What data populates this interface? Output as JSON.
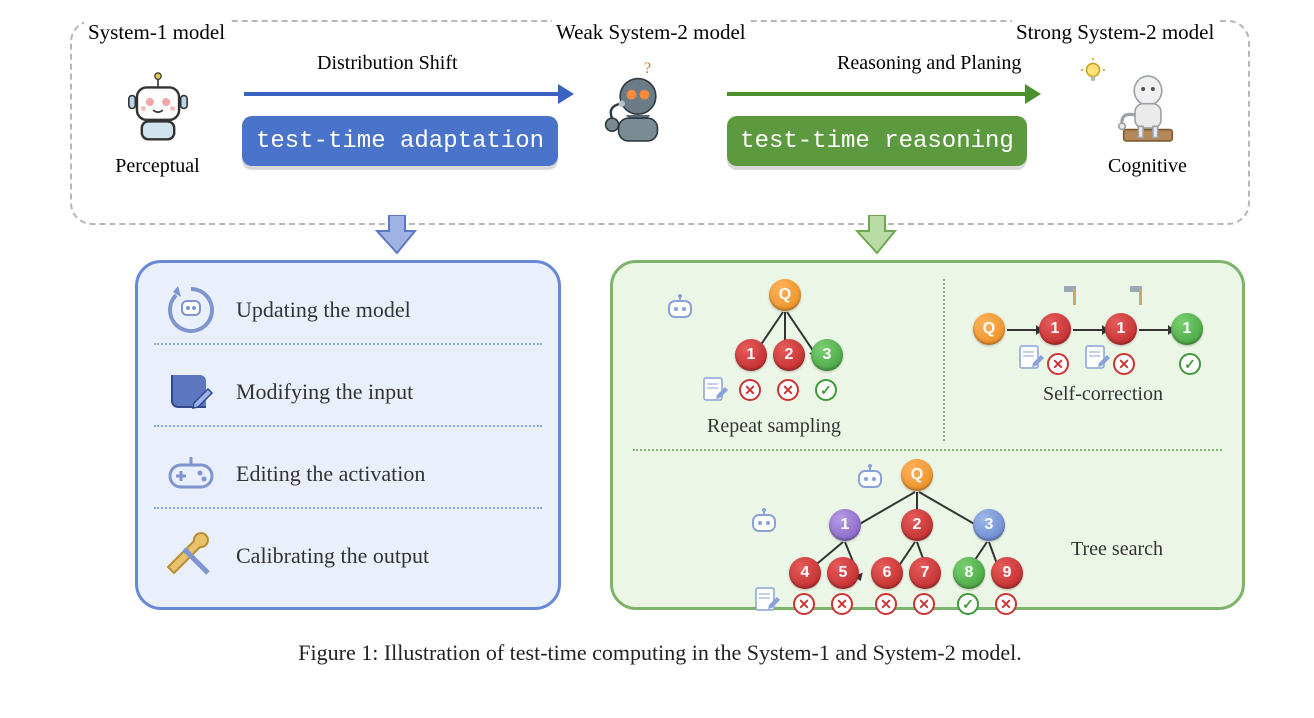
{
  "top": {
    "system1": "System-1 model",
    "weak2": "Weak System-2 model",
    "strong2": "Strong System-2 model",
    "dist": "Distribution Shift",
    "reason": "Reasoning and Planing",
    "tta": "test-time adaptation",
    "ttr": "test-time reasoning",
    "perceptual": "Perceptual",
    "cognitive": "Cognitive"
  },
  "left_panel": {
    "items": [
      "Updating the model",
      "Modifying the input",
      "Editing the activation",
      "Calibrating the output"
    ]
  },
  "right_panel": {
    "repeat": "Repeat sampling",
    "selfc": "Self-correction",
    "tree": "Tree search",
    "Q": "Q",
    "n1": "1",
    "n2": "2",
    "n3": "3",
    "n4": "4",
    "n5": "5",
    "n6": "6",
    "n7": "7",
    "n8": "8",
    "n9": "9",
    "ok": "✓",
    "no": "✕"
  },
  "caption": "Figure 1: Illustration of test-time computing in the System-1 and System-2 model."
}
